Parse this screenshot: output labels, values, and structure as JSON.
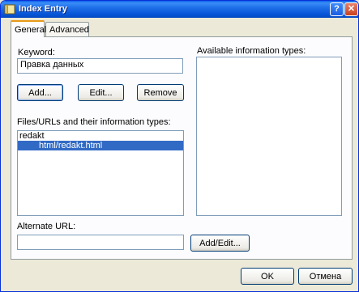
{
  "window": {
    "title": "Index Entry"
  },
  "tabs": [
    {
      "label": "General"
    },
    {
      "label": "Advanced"
    }
  ],
  "keyword": {
    "label": "Keyword:",
    "value": "Правка данных"
  },
  "keyword_buttons": {
    "add": "Add...",
    "edit": "Edit...",
    "remove": "Remove"
  },
  "files": {
    "label": "Files/URLs and their information types:",
    "items": [
      {
        "text": "redakt"
      },
      {
        "text": "html/redakt.html"
      }
    ]
  },
  "info_types": {
    "label": "Available information types:"
  },
  "alternate_url": {
    "label": "Alternate URL:",
    "value": ""
  },
  "add_edit_button": "Add/Edit...",
  "dialog_buttons": {
    "ok": "OK",
    "cancel": "Отмена"
  }
}
